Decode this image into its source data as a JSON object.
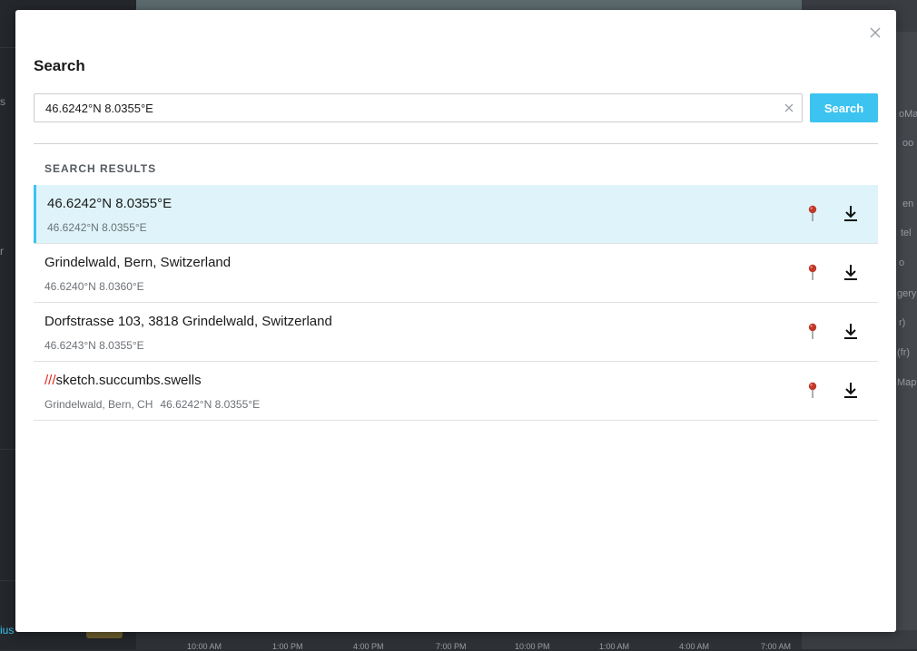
{
  "modal": {
    "title": "Search",
    "close_icon": "close-icon"
  },
  "search": {
    "value": "46.6242°N 8.0355°E",
    "placeholder": "",
    "button_label": "Search",
    "clear_icon": "clear-icon"
  },
  "results": {
    "heading": "SEARCH RESULTS",
    "items": [
      {
        "title": "46.6242°N 8.0355°E",
        "prefix": "",
        "subtitle": "46.6242°N 8.0355°E",
        "subtitle2": "",
        "selected": true
      },
      {
        "title": "Grindelwald, Bern, Switzerland",
        "prefix": "",
        "subtitle": "46.6240°N 8.0360°E",
        "subtitle2": "",
        "selected": false
      },
      {
        "title": "Dorfstrasse 103, 3818 Grindelwald, Switzerland",
        "prefix": "",
        "subtitle": "46.6243°N 8.0355°E",
        "subtitle2": "",
        "selected": false
      },
      {
        "title": "sketch.succumbs.swells",
        "prefix": "///",
        "subtitle": "Grindelwald, Bern, CH",
        "subtitle2": "46.6242°N 8.0355°E",
        "selected": false
      }
    ]
  },
  "background": {
    "timeline_ticks": [
      "10:00 AM",
      "1:00 PM",
      "4:00 PM",
      "7:00 PM",
      "10:00 PM",
      "1:00 AM",
      "4:00 AM",
      "7:00 AM"
    ],
    "right_fragments": [
      "oMa",
      "oo",
      "en",
      "tel",
      "o",
      "gery",
      "r)",
      "(fr)",
      "Map"
    ],
    "left_fragments": [
      "s",
      "r",
      "ius"
    ]
  },
  "colors": {
    "accent": "#3cc3f0",
    "selected_row": "#def4fa",
    "pin": "#c0392b",
    "w3w_red": "#e1251b"
  }
}
